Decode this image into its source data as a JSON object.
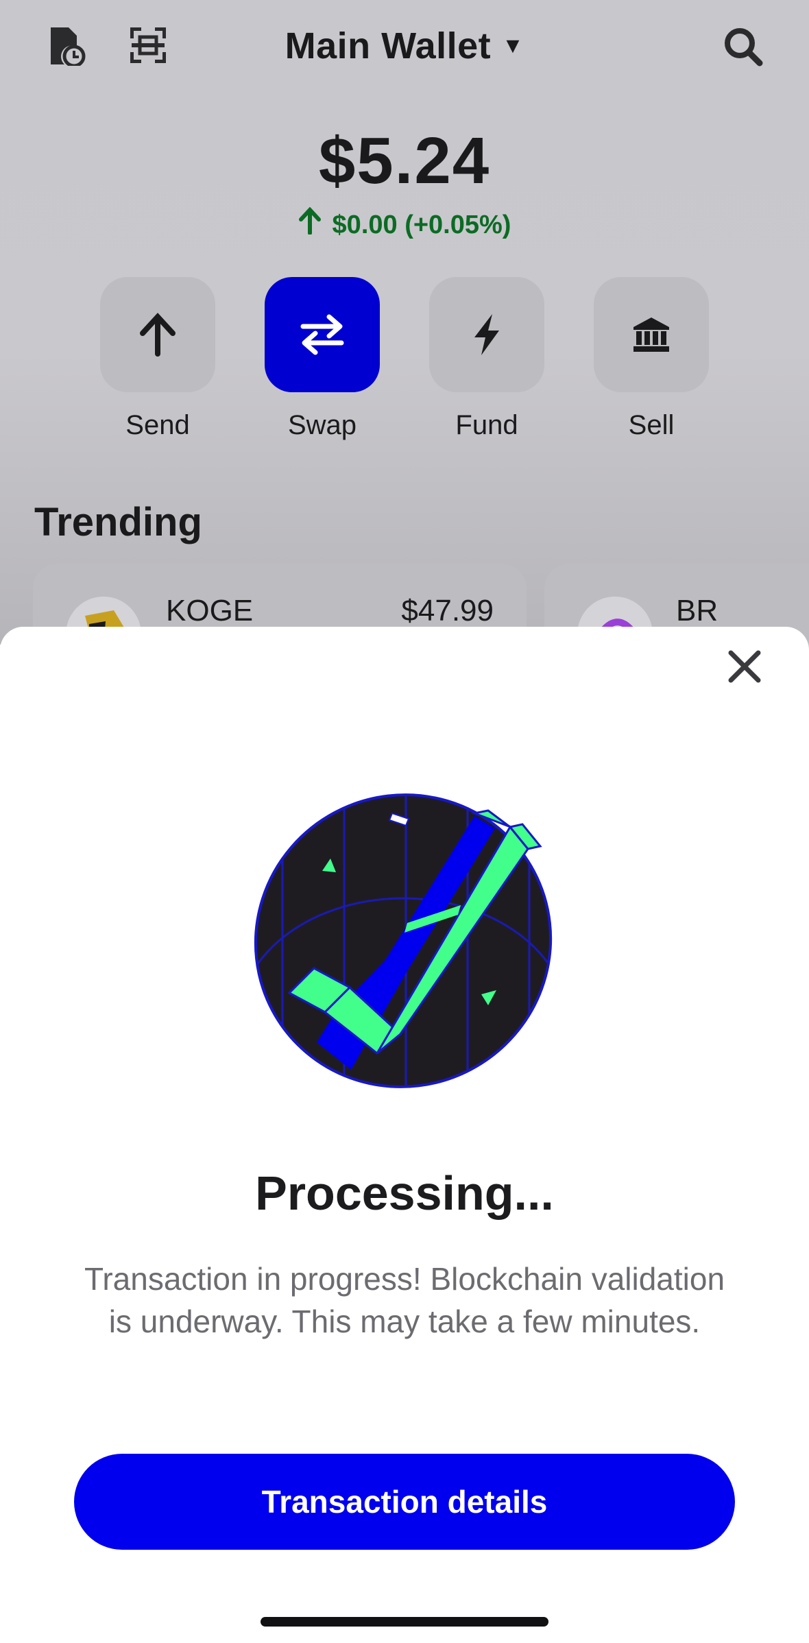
{
  "header": {
    "wallet_name": "Main Wallet",
    "icons": [
      "history-icon",
      "scan-icon",
      "search-icon"
    ]
  },
  "balance": {
    "amount": "$5.24",
    "change": "$0.00 (+0.05%)",
    "change_color": "#0c6b24"
  },
  "actions": [
    {
      "label": "Send",
      "icon": "arrow-up-icon"
    },
    {
      "label": "Swap",
      "icon": "swap-icon"
    },
    {
      "label": "Fund",
      "icon": "bolt-icon"
    },
    {
      "label": "Sell",
      "icon": "bank-icon"
    }
  ],
  "trending": {
    "heading": "Trending",
    "cards": [
      {
        "name": "KOGE",
        "price": "$47.99"
      },
      {
        "name": "BR",
        "price": ""
      }
    ]
  },
  "sheet": {
    "title": "Processing...",
    "message": "Transaction in progress! Blockchain validation is underway. This may take a few minutes.",
    "button_label": "Transaction details"
  },
  "colors": {
    "accent": "#0000ee",
    "check_green": "#42ff8c",
    "illustration_dark": "#1e1c21"
  }
}
